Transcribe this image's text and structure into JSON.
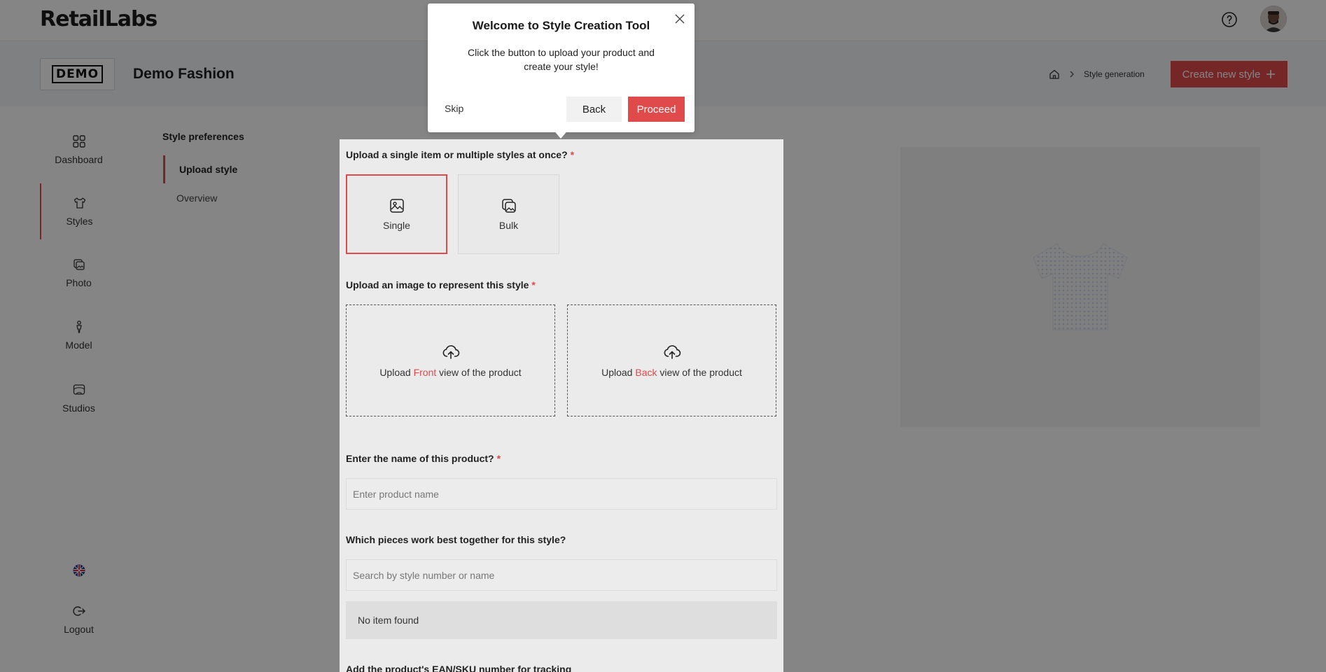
{
  "app": {
    "logo": "RetailLabs"
  },
  "header": {
    "brand_logo_text": "DEMO",
    "company_name": "Demo Fashion",
    "breadcrumb_current": "Style generation",
    "create_button_label": "Create new style"
  },
  "sidebar": {
    "items": [
      {
        "label": "Dashboard",
        "icon": "grid-icon"
      },
      {
        "label": "Styles",
        "icon": "shirt-icon",
        "active": true
      },
      {
        "label": "Photo",
        "icon": "photo-stack-icon"
      },
      {
        "label": "Model",
        "icon": "person-icon"
      },
      {
        "label": "Studios",
        "icon": "studio-icon"
      }
    ],
    "language_icon": "uk-flag-icon",
    "logout_label": "Logout"
  },
  "steps": {
    "title": "Style preferences",
    "items": [
      {
        "label": "Upload style",
        "active": true
      },
      {
        "label": "Overview",
        "active": false
      }
    ]
  },
  "form": {
    "q_upload_type": "Upload a single item or multiple styles at once?",
    "option_single": "Single",
    "option_bulk": "Bulk",
    "q_image": "Upload an image to represent this style",
    "upload_front": {
      "prefix": "Upload",
      "highlight": "Front",
      "suffix": "view of the product"
    },
    "upload_back": {
      "prefix": "Upload",
      "highlight": "Back",
      "suffix": "view of the product"
    },
    "q_name": "Enter the name of this product?",
    "name_placeholder": "Enter product name",
    "q_pieces": "Which pieces work best together for this style?",
    "pieces_placeholder": "Search by style number or name",
    "no_item_text": "No item found",
    "q_ean": "Add the product's EAN/SKU number for tracking"
  },
  "tour": {
    "title": "Welcome to Style Creation Tool",
    "body": "Click the button to upload your product and create your style!",
    "skip_label": "Skip",
    "back_label": "Back",
    "proceed_label": "Proceed"
  },
  "colors": {
    "accent": "#e04a4a",
    "overlay": "rgba(0,0,0,0.48)"
  }
}
